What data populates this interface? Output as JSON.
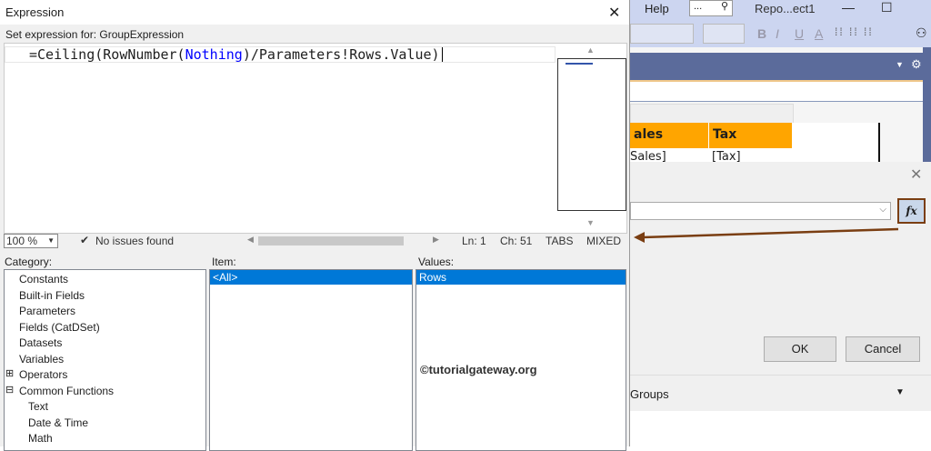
{
  "background_app": {
    "menu_help": "Help",
    "search_box": "...",
    "title": "Repo...ect1",
    "format_buttons": [
      "B",
      "I",
      "U",
      "A"
    ],
    "table_headers": [
      "ales",
      "Tax"
    ],
    "table_cells": [
      "Sales]",
      "[Tax]"
    ],
    "groups_label": "Groups"
  },
  "group_dialog": {
    "ok": "OK",
    "cancel": "Cancel",
    "fx": "fx"
  },
  "expression_dialog": {
    "title": "Expression",
    "set_label": "Set expression for: GroupExpression",
    "code": {
      "prefix": "=Ceiling(RowNumber(",
      "keyword": "Nothing",
      "suffix": ")/Parameters!Rows.Value)"
    },
    "status": {
      "zoom": "100 %",
      "issues": "No issues found",
      "ln": "Ln: 1",
      "ch": "Ch: 51",
      "tabs": "TABS",
      "mixed": "MIXED"
    },
    "category_label": "Category:",
    "item_label": "Item:",
    "values_label": "Values:",
    "categories": [
      "Constants",
      "Built-in Fields",
      "Parameters",
      "Fields (CatDSet)",
      "Datasets",
      "Variables",
      "Operators",
      "Common Functions",
      "Text",
      "Date & Time",
      "Math"
    ],
    "items": [
      "<All>"
    ],
    "values": [
      "Rows"
    ],
    "watermark": "©tutorialgateway.org"
  },
  "colors": {
    "accent": "#0078d7",
    "arrow": "#7a3e12",
    "header_orange": "#ffa500"
  }
}
